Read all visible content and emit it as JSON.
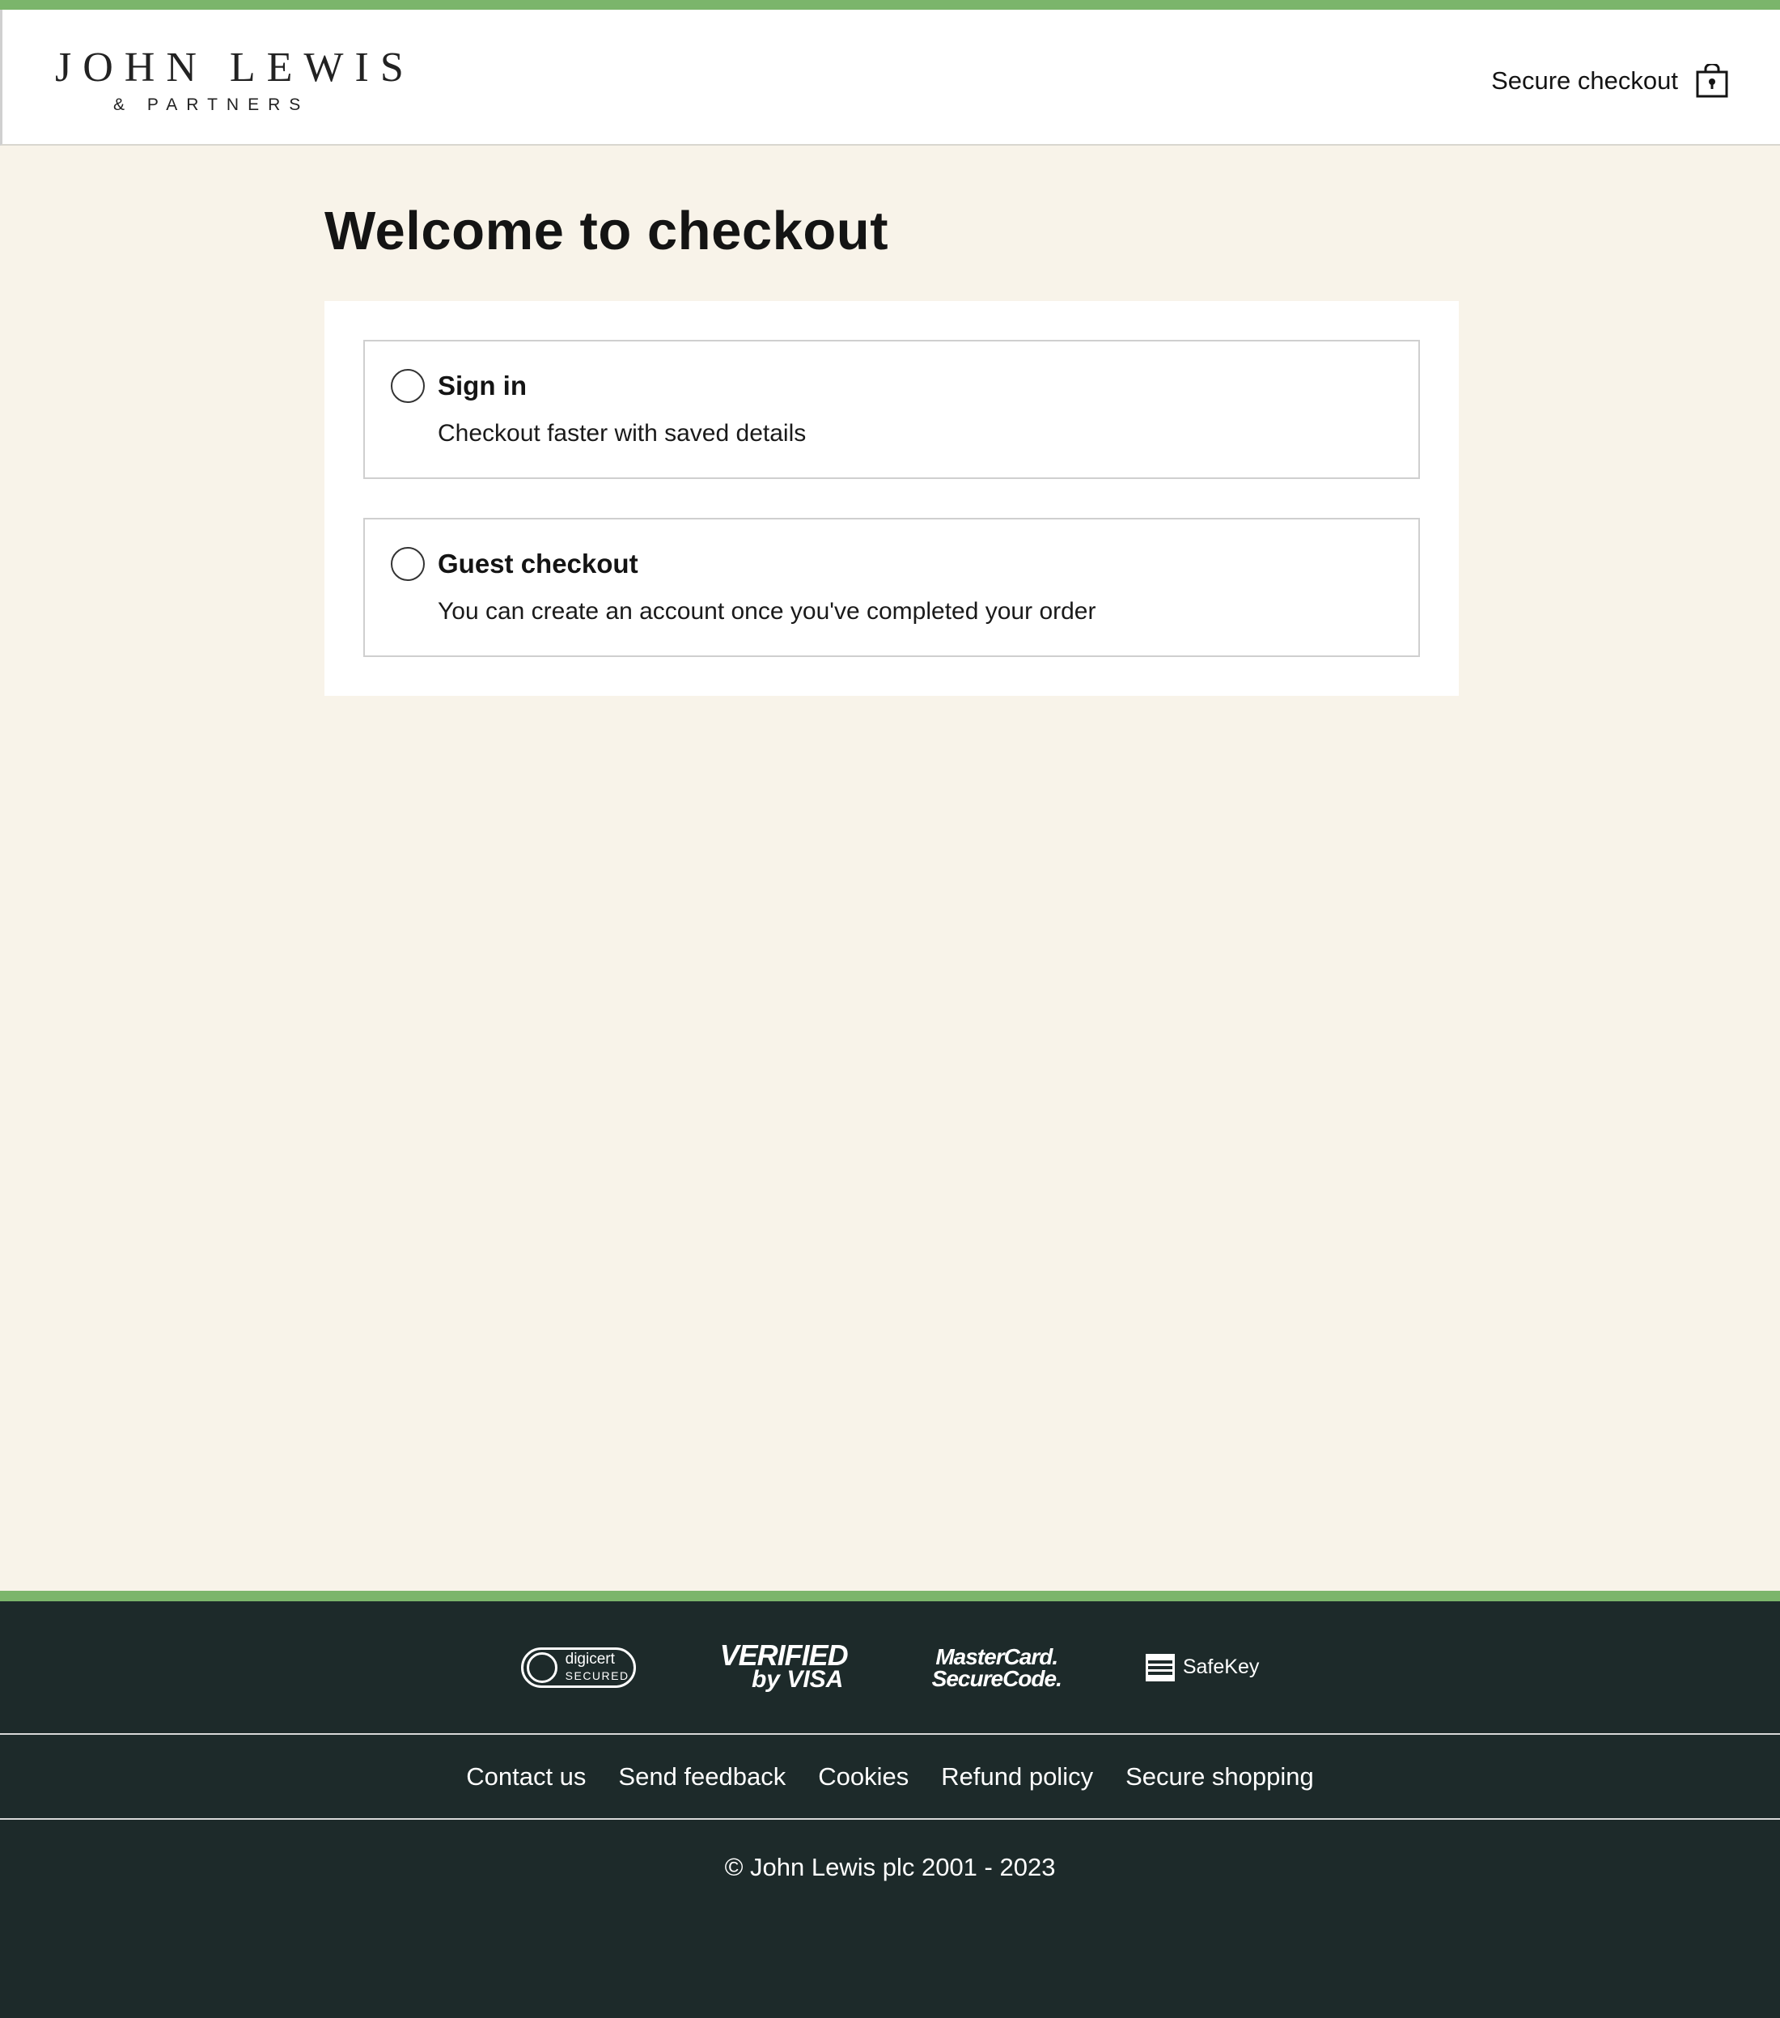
{
  "header": {
    "logo_main": "JOHN LEWIS",
    "logo_sub": "& PARTNERS",
    "secure_label": "Secure checkout",
    "secure_icon": "lock-icon"
  },
  "main": {
    "title": "Welcome to checkout",
    "options": [
      {
        "title": "Sign in",
        "description": "Checkout faster with saved details",
        "selected": false
      },
      {
        "title": "Guest checkout",
        "description": "You can create an account once you've completed your order",
        "selected": false
      }
    ]
  },
  "footer": {
    "badges": {
      "digicert_line1": "digicert",
      "digicert_line2": "SECURED",
      "visa_line1": "VERIFIED",
      "visa_line2": "by VISA",
      "mc_line1": "MasterCard.",
      "mc_line2": "SecureCode.",
      "safekey": "SafeKey"
    },
    "links": [
      "Contact us",
      "Send feedback",
      "Cookies",
      "Refund policy",
      "Secure shopping"
    ],
    "copyright": "© John Lewis plc 2001 - 2023"
  },
  "colors": {
    "accent_green": "#7bb56b",
    "page_bg": "#f8f3e9",
    "footer_bg": "#1d2a2a"
  }
}
